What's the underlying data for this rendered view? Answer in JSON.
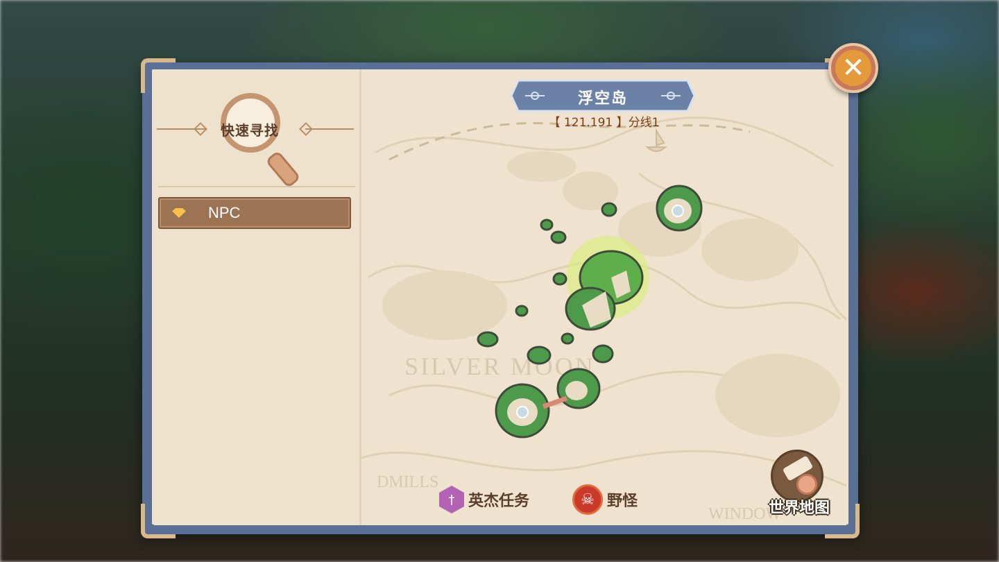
{
  "sidebar": {
    "search_title": "快速寻找",
    "categories": [
      {
        "label": "NPC"
      }
    ]
  },
  "map": {
    "title": "浮空岛",
    "coords": "【 121.191 】分线1",
    "watermarks": [
      "SILVER MOON",
      "DMILLS",
      "WINDOW"
    ],
    "legend": [
      {
        "label": "英杰任务",
        "icon": "hero-quest-icon",
        "color": "#b463b4"
      },
      {
        "label": "野怪",
        "icon": "skull-icon",
        "color": "#c93a2a"
      }
    ],
    "world_map_label": "世界地图"
  },
  "close_icon": "close-icon"
}
